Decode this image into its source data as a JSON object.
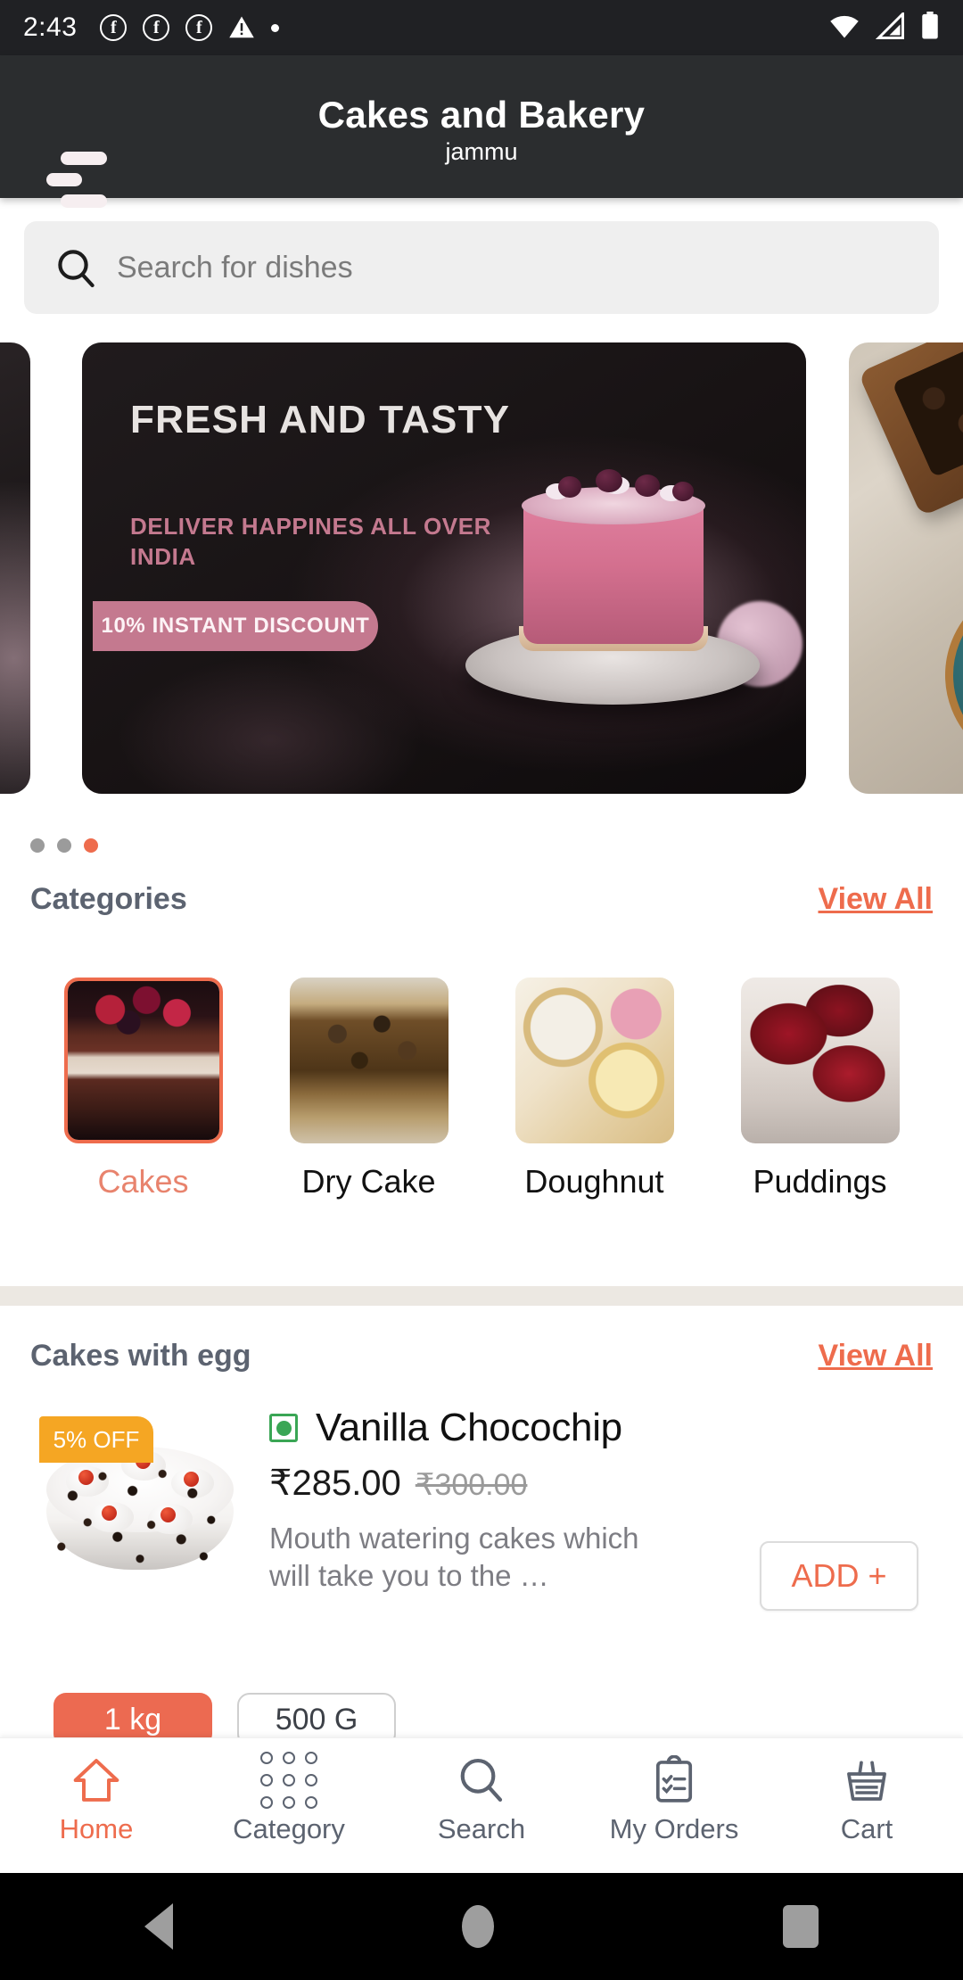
{
  "status_bar": {
    "clock": "2:43",
    "left_icons": [
      "facebook-icon",
      "facebook-icon",
      "facebook-icon",
      "warning-icon",
      "dot-icon"
    ],
    "right_icons": [
      "wifi-icon",
      "signal-icon",
      "battery-icon"
    ]
  },
  "app_bar": {
    "menu_icon": "hamburger-menu-icon",
    "title": "Cakes and Bakery",
    "subtitle": "jammu"
  },
  "search": {
    "icon": "search-icon",
    "placeholder": "Search for dishes",
    "value": ""
  },
  "carousel": {
    "banner": {
      "title": "FRESH AND TASTY",
      "subtitle": "DELIVER HAPPINES ALL OVER INDIA",
      "pill": "10% INSTANT DISCOUNT"
    },
    "dots": {
      "count": 3,
      "active_index": 2,
      "active_color": "#ee6c4d",
      "inactive_color": "#9b9b9b"
    }
  },
  "categories_section": {
    "title": "Categories",
    "view_all": "View All",
    "items": [
      {
        "label": "Cakes",
        "active": true,
        "thumb": "cake-with-berries-photo"
      },
      {
        "label": "Dry Cake",
        "active": false,
        "thumb": "dry-cake-photo"
      },
      {
        "label": "Doughnut",
        "active": false,
        "thumb": "doughnut-photo"
      },
      {
        "label": "Puddings",
        "active": false,
        "thumb": "puddings-photo"
      }
    ]
  },
  "product_section": {
    "title": "Cakes with egg",
    "view_all": "View All",
    "products": [
      {
        "badge": "5% OFF",
        "veg_indicator": "veg-green",
        "name": "Vanilla Chocochip",
        "price": "₹285.00",
        "old_price": "₹300.00",
        "description": "Mouth watering cakes which will take you to the …",
        "add_label": "ADD +",
        "weights": [
          {
            "label": "1 kg",
            "selected": true
          },
          {
            "label": "500 G",
            "selected": false
          }
        ]
      }
    ]
  },
  "bottom_nav": {
    "items": [
      {
        "label": "Home",
        "icon": "home-icon",
        "active": true
      },
      {
        "label": "Category",
        "icon": "grid-dots-icon",
        "active": false
      },
      {
        "label": "Search",
        "icon": "search-icon",
        "active": false
      },
      {
        "label": "My Orders",
        "icon": "clipboard-checklist-icon",
        "active": false
      },
      {
        "label": "Cart",
        "icon": "basket-icon",
        "active": false
      }
    ]
  },
  "android_nav": {
    "back": "back-triangle-icon",
    "home": "home-circle-icon",
    "recents": "recents-square-icon"
  },
  "theme": {
    "accent": "#ee6c4d",
    "badge": "#f5a623",
    "veg": "#3aa655",
    "appbar_bg": "#2b2d2f",
    "statusbar_bg": "#202124"
  }
}
